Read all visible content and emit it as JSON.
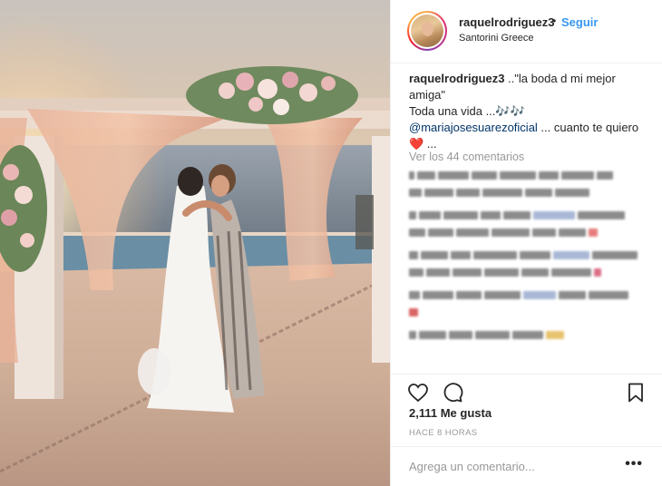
{
  "post": {
    "username": "raquelrodriguez3",
    "separator": "•",
    "follow_label": "Seguir",
    "location": "Santorini Greece",
    "caption": {
      "username": "raquelrodriguez3",
      "line1": " ..\"la boda d mi mejor amiga\"",
      "line2": "Toda una vida ...🎶🎶",
      "mention": "@mariajosesuarezoficial",
      "line3_rest": " ... cuanto te quiero",
      "heart": "❤️",
      "line4": " ..."
    },
    "view_comments_label": "Ver los 44 comentarios",
    "likes_label": "2,111 Me gusta",
    "time_label": "HACE 8 HORAS",
    "comment_placeholder": "Agrega un comentario...",
    "more_label": "•••"
  },
  "icons": {
    "like": "heart-outline-icon",
    "comment": "speech-bubble-icon",
    "save": "bookmark-icon",
    "avatar": "profile-picture"
  },
  "colors": {
    "link": "#3897f0",
    "mention": "#003569",
    "muted": "#999999",
    "text": "#262626"
  }
}
